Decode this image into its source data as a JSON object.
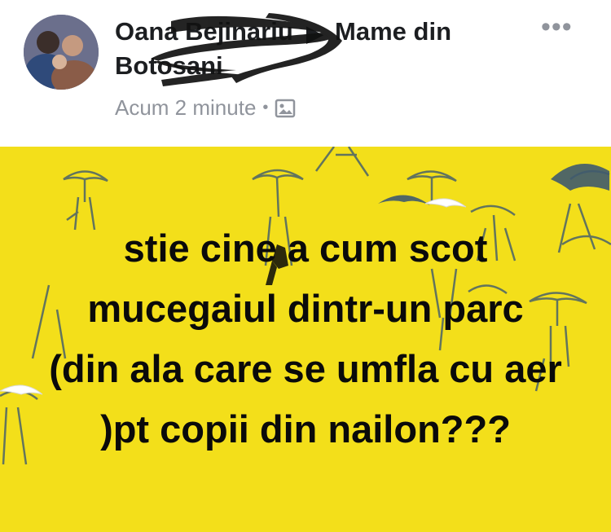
{
  "post": {
    "author_name": "Oana Bejinariu",
    "group_name": "Mame din",
    "group_name_line2": "Botosani",
    "timestamp": "Acum 2 minute",
    "separator": "•",
    "privacy_icon": "photo-icon",
    "more_icon": "more-horizontal-icon",
    "more_label": "•••",
    "text": "stie cine a cum scot mucegaiul dintr-un parc (din ala care se umfla cu aer )pt copii din nailon???",
    "background_color": "#f3df1a",
    "text_color": "#0a0a0a"
  }
}
